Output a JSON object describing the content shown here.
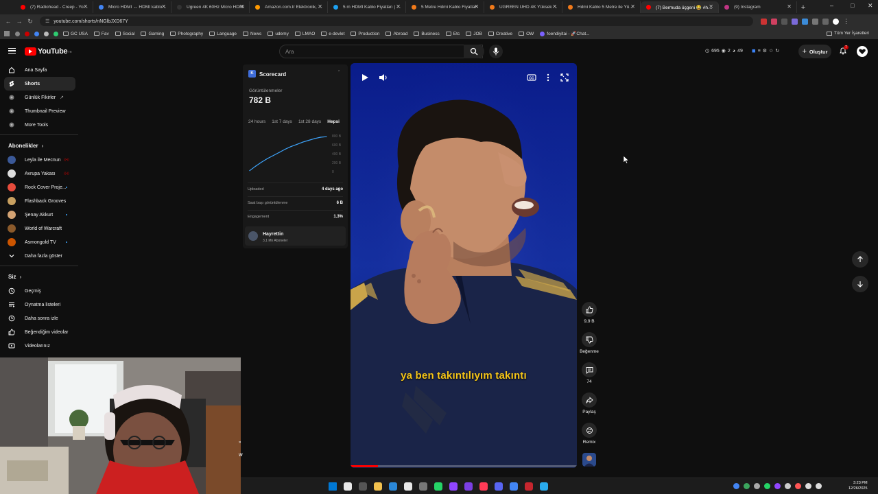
{
  "browser": {
    "tabs": [
      {
        "title": "(7) Radiohead - Creep - YouTube",
        "color": "#ff0000"
      },
      {
        "title": "Micro HDMI ↔ HDMI kablo - Google",
        "color": "#4285f4"
      },
      {
        "title": "Ugreen 4K 60Hz Micro HDMI",
        "color": "#333333"
      },
      {
        "title": "Amazon.com.tr Elektronik, bilgisayar",
        "color": "#ff9900"
      },
      {
        "title": "5 m HDMI Kablo Fiyatları | En",
        "color": "#1da1f2"
      },
      {
        "title": "5 Metre Hdmi Kablo Fiyatları",
        "color": "#f27a1a"
      },
      {
        "title": "UGREEN UHD 4K Yüksek Hız",
        "color": "#f27a1a"
      },
      {
        "title": "Hdmi Kablo 5 Metre ile Yüksek",
        "color": "#f27a1a"
      },
      {
        "title": "(7) Bermuda üçgeni 😂 #hayır",
        "color": "#ff0000"
      },
      {
        "title": "(9) Instagram",
        "color": "#c13584"
      }
    ],
    "url": "youtube.com/shorts/nNGlbJXD67Y",
    "bookmarks": [
      {
        "label": "",
        "type": "icon",
        "color": "#888"
      },
      {
        "label": "",
        "type": "icon",
        "color": "#cc0000"
      },
      {
        "label": "",
        "type": "icon",
        "color": "#4285f4"
      },
      {
        "label": "",
        "type": "icon",
        "color": "#bbbbbb"
      },
      {
        "label": "",
        "type": "icon",
        "color": "#2ecc71"
      },
      {
        "label": "GC USA",
        "type": "folder"
      },
      {
        "label": "Fav",
        "type": "folder"
      },
      {
        "label": "Social",
        "type": "folder"
      },
      {
        "label": "Gaming",
        "type": "folder"
      },
      {
        "label": "Photography",
        "type": "folder"
      },
      {
        "label": "Language",
        "type": "folder"
      },
      {
        "label": "News",
        "type": "folder"
      },
      {
        "label": "udemy",
        "type": "folder"
      },
      {
        "label": "LMAO",
        "type": "folder"
      },
      {
        "label": "e-devlet",
        "type": "folder"
      },
      {
        "label": "Production",
        "type": "folder"
      },
      {
        "label": "Abroad",
        "type": "folder"
      },
      {
        "label": "Business",
        "type": "folder"
      },
      {
        "label": "Etc",
        "type": "folder"
      },
      {
        "label": "JOB",
        "type": "folder"
      },
      {
        "label": "Creative",
        "type": "folder"
      },
      {
        "label": "OW",
        "type": "folder"
      },
      {
        "label": "foendiyitai - 🚀Chat...",
        "type": "icon",
        "color": "#7b61ff"
      }
    ],
    "all_bookmarks": "Tüm Yer İşaretleri"
  },
  "youtube": {
    "logo_text": "YouTube",
    "logo_region": "TR",
    "search_placeholder": "Ara",
    "stats": {
      "views": "695",
      "a": "2",
      "b": "49"
    },
    "create_label": "Oluştur",
    "notif_count": "7"
  },
  "sidebar": {
    "main": [
      {
        "label": "Ana Sayfa",
        "icon": "home-icon"
      },
      {
        "label": "Shorts",
        "icon": "shorts-icon",
        "active": true
      },
      {
        "label": "Günlük Fikirler",
        "icon": "idea-icon"
      },
      {
        "label": "Thumbnail Preview",
        "icon": "preview-icon"
      },
      {
        "label": "More Tools",
        "icon": "tools-icon"
      }
    ],
    "subs_header": "Abonelikler",
    "subscriptions": [
      {
        "label": "Leyla ile Mecnun",
        "color": "#3b5998",
        "badge": "live"
      },
      {
        "label": "Avrupa Yakası",
        "color": "#dddddd",
        "badge": "live"
      },
      {
        "label": "Rock Cover Proje...",
        "color": "#e74c3c",
        "badge": "dot"
      },
      {
        "label": "Flashback Grooves",
        "color": "#c8a060",
        "badge": ""
      },
      {
        "label": "Şenay Akkurt",
        "color": "#d4a373",
        "badge": "dot"
      },
      {
        "label": "World of Warcraft",
        "color": "#8b5a2b",
        "badge": ""
      },
      {
        "label": "Asmongold TV",
        "color": "#cc5500",
        "badge": "dot"
      }
    ],
    "show_more": "Daha fazla göster",
    "you_header": "Siz",
    "you": [
      {
        "label": "Geçmiş",
        "icon": "history-icon"
      },
      {
        "label": "Oynatma listeleri",
        "icon": "playlist-icon"
      },
      {
        "label": "Daha sonra izle",
        "icon": "watch-later-icon"
      },
      {
        "label": "Beğendiğim videolar",
        "icon": "like-icon"
      },
      {
        "label": "Videolarınız",
        "icon": "video-icon"
      }
    ]
  },
  "scorecard": {
    "title": "Scorecard",
    "logo": "K",
    "views_label": "Görüntülenmeler",
    "views": "782 B",
    "periods": [
      "24 hours",
      "1st 7 days",
      "1st 28 days",
      "Hepsi"
    ],
    "selected_period": "Hepsi",
    "rows": [
      {
        "label": "Uploaded",
        "value": "4 days ago"
      },
      {
        "label": "Saat başı görüntülenme",
        "value": "6 B"
      },
      {
        "label": "Engagement",
        "value": "1.3%"
      }
    ],
    "channel_name": "Hayrettin",
    "channel_subs": "3,1 Mn Aboneler"
  },
  "chart_data": {
    "type": "line",
    "title": "",
    "ylabel": "",
    "y_ticks": [
      "800 B",
      "600 B",
      "400 B",
      "200 B",
      "0"
    ],
    "ylim": [
      0,
      800
    ],
    "values": [
      20,
      120,
      210,
      290,
      360,
      430,
      500,
      560,
      610,
      660,
      700,
      740,
      770,
      782
    ],
    "line_color": "#3ea6ff"
  },
  "video": {
    "subtitle": "ya ben takıntılıyım takıntı",
    "progress_fraction": 0.12
  },
  "actions": [
    {
      "name": "like",
      "label": "9,9 B"
    },
    {
      "name": "dislike",
      "label": "Beğenme"
    },
    {
      "name": "comments",
      "label": "74"
    },
    {
      "name": "share",
      "label": "Paylaş"
    },
    {
      "name": "remix",
      "label": "Remix"
    }
  ],
  "webcam_edge_text": "»\nW",
  "taskbar": {
    "time": "3:23 PM",
    "date": "12/26/2025"
  }
}
